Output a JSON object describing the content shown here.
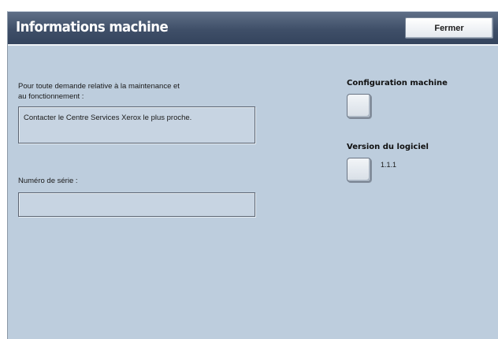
{
  "window": {
    "title": "Informations machine",
    "close_label": "Fermer"
  },
  "support": {
    "label_line1": "Pour toute demande relative à la maintenance et",
    "label_line2": "au fonctionnement :",
    "value": "Contacter le Centre Services Xerox le plus proche."
  },
  "serial": {
    "label": "Numéro de série :",
    "value": ""
  },
  "machine_config": {
    "label": "Configuration machine"
  },
  "software_version": {
    "label": "Version du logiciel",
    "value": "1.1.1"
  }
}
